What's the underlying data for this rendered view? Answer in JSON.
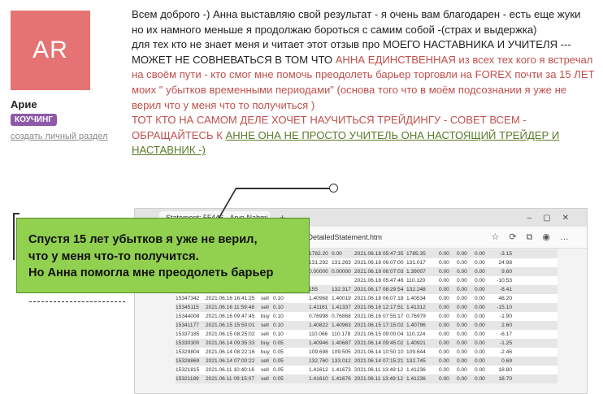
{
  "sidebar": {
    "avatar_initials": "AR",
    "username": "Арие",
    "badge": "КОУЧИНГ",
    "link": "создать личный раздел"
  },
  "post": {
    "p1": "Всем доброго -) Анна выставляю свой результат - я очень вам благодарен  - есть еще жуки но их намного меньше я продолжаю бороться с самим собой -(страх и выдержка)",
    "p2_a": "для тех кто не знает меня и читает этот отзыв про МОЕГО НАСТАВНИКА И УЧИТЕЛЯ --- МОЖЕТ НЕ СОВНЕВАТЬСЯ В ТОМ ЧТО ",
    "p2_red": "АННА ЕДИНСТВЕННАЯ из всех тех кого я встречал на своём пути -  кто смог мне помочь преодолеть барьер торговли на FOREX почти за 15 ЛЕТ моих  \" убытков временными периодами\" (основа того что в моём  подсознании я уже не верил что  у меня что то  получиться )",
    "p3_red": "ТОТ КТО НА САМОМ ДЕЛЕ ХОЧЕТ НАУЧИТЬСЯ ТРЕЙДИНГУ - СОВЕТ ВСЕМ - ОБРАЩАЙТЕСЬ К ",
    "p3_green": "АННЕ ОНА НЕ ПРОСТО УЧИТЕЛЬ ОНА НАСТОЯЩИЙ  ТРЕЙДЕР И НАСТАВНИК -)"
  },
  "screenshot": {
    "tab_title": "Statement: 55446 - Arye Nahmi",
    "url": "p/DetailedStatement.htm",
    "rows": [
      [
        "",
        "",
        "",
        "",
        "1782.20",
        "0.00",
        "2021.06.18 05:47:35",
        "1785.35",
        "0.00",
        "0.00",
        "0.00",
        "-3.15"
      ],
      [
        "",
        "",
        "",
        "",
        "131.292",
        "131.263",
        "2021.06.18 06:07:00",
        "131.017",
        "0.00",
        "0.00",
        "0.00",
        "24.98"
      ],
      [
        "",
        "",
        "",
        "",
        "0.00000",
        "0.00000",
        "2021.06.18 06:07:03",
        "1.39007",
        "0.00",
        "0.00",
        "0.00",
        "9.60"
      ],
      [
        "",
        "",
        "",
        "",
        "",
        "",
        "2021.06.18 05:47:46",
        "110.120",
        "0.00",
        "0.00",
        "0.00",
        "-10.53"
      ],
      [
        "",
        "",
        "",
        "",
        "155",
        "132.317",
        "2021.06.17 08:29:54",
        "132.248",
        "0.00",
        "0.00",
        "0.00",
        "-8.41"
      ],
      [
        "15347342",
        "2021.06.16 16:41:25",
        "sell",
        "0.10",
        "1.40968",
        "1.40019",
        "2021.06.18 06:07:18",
        "1.40534",
        "0.00",
        "0.00",
        "0.00",
        "48.20"
      ],
      [
        "15345115",
        "2021.06.16 11:59:48",
        "sell",
        "0.10",
        "1.41161",
        "1.41337",
        "2021.06.16 12:17:51",
        "1.41312",
        "0.00",
        "0.00",
        "0.00",
        "-15.10"
      ],
      [
        "15344008",
        "2021.06.16 09:47:45",
        "buy",
        "0.10",
        "0.76998",
        "0.76868",
        "2021.06.16 07:55:17",
        "0.76979",
        "0.00",
        "0.00",
        "0.00",
        "-1.90"
      ],
      [
        "15341177",
        "2021.06.15 15:50:01",
        "sell",
        "0.10",
        "1.40822",
        "1.40963",
        "2021.06.15 17:15:02",
        "1.40796",
        "0.00",
        "0.00",
        "0.00",
        "2.60"
      ],
      [
        "15337185",
        "2021.06.15 08:25:02",
        "sell",
        "0.10",
        "110.066",
        "110.178",
        "2021.06.15 09:00:04",
        "110.124",
        "0.00",
        "0.00",
        "0.00",
        "-6.17"
      ],
      [
        "15330300",
        "2021.06.14 09:35:33",
        "buy",
        "0.05",
        "1.40946",
        "1.40687",
        "2021.06.14 09:45:02",
        "1.40921",
        "0.00",
        "0.00",
        "0.00",
        "-1.25"
      ],
      [
        "15329804",
        "2021.06.14 08:22:16",
        "buy",
        "0.05",
        "109.698",
        "109.505",
        "2021.06.14 10:50:10",
        "109.644",
        "0.00",
        "0.00",
        "0.00",
        "-2.46"
      ],
      [
        "15328869",
        "2021.06.14 07:00:22",
        "sell",
        "0.05",
        "132.760",
        "133.012",
        "2021.06.14 07:15:21",
        "132.745",
        "0.00",
        "0.00",
        "0.00",
        "0.69"
      ],
      [
        "15321815",
        "2021.06.11 10:40:16",
        "sell",
        "0.05",
        "1.41612",
        "1.41673",
        "2021.06.11 13:49:12",
        "1.41236",
        "0.00",
        "0.00",
        "0.00",
        "18.80"
      ],
      [
        "15321189",
        "2021.06.11 09:15:07",
        "sell",
        "0.05",
        "1.41610",
        "1.41676",
        "2021.06.11 13:49:12",
        "1.41236",
        "0.00",
        "0.00",
        "0.00",
        "18.70"
      ]
    ]
  },
  "callout": {
    "line1": "Спустя 15 лет убытков я уже не верил,",
    "line2": "что у меня что-то получится.",
    "line3": "Но Анна помогла мне преодолеть барьер"
  },
  "colors": {
    "avatar": "#e57373",
    "badge": "#8e5aa8",
    "callout": "#92d050",
    "highlight_red": "#c0504d",
    "highlight_green": "#5a7a2a"
  }
}
